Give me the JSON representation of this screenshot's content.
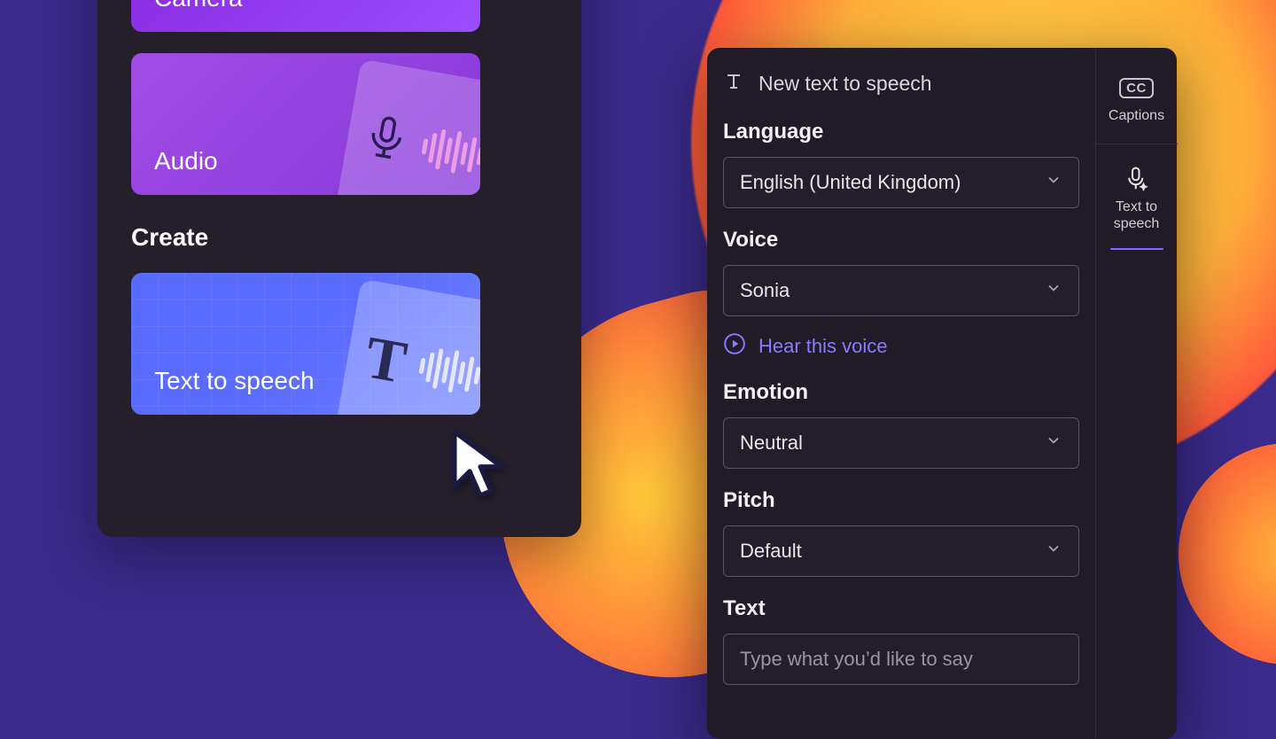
{
  "left": {
    "cards": {
      "camera_label": "Camera",
      "audio_label": "Audio",
      "tts_label": "Text to speech"
    },
    "create_heading": "Create"
  },
  "panel": {
    "title": "New text to speech",
    "language": {
      "label": "Language",
      "value": "English (United Kingdom)"
    },
    "voice": {
      "label": "Voice",
      "value": "Sonia",
      "hear": "Hear this voice"
    },
    "emotion": {
      "label": "Emotion",
      "value": "Neutral"
    },
    "pitch": {
      "label": "Pitch",
      "value": "Default"
    },
    "text": {
      "label": "Text",
      "placeholder": "Type what you’d like to say"
    }
  },
  "side": {
    "captions_label": "Captions",
    "tts_label": "Text to speech"
  },
  "colors": {
    "accent": "#8a7aff",
    "panel_bg": "#201b26",
    "bg": "#3a2a8a"
  }
}
